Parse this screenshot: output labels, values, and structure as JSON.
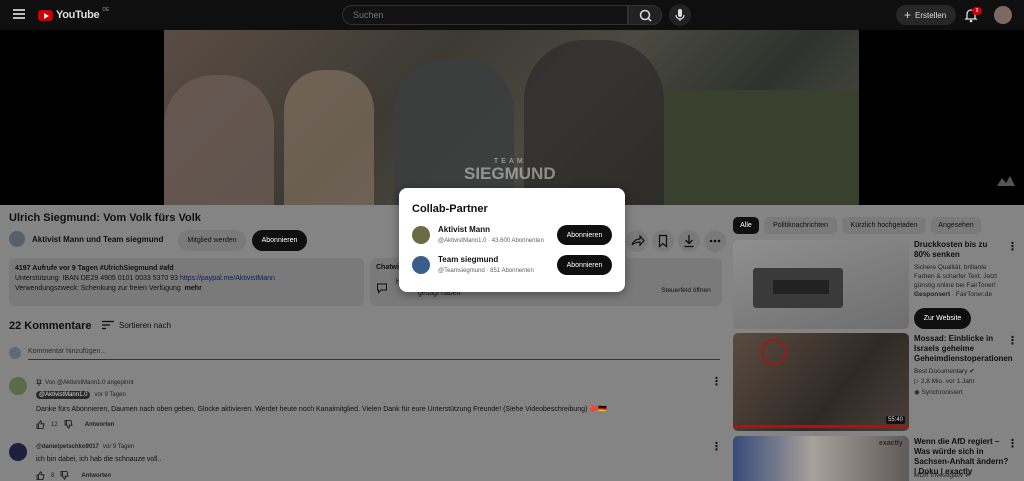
{
  "header": {
    "logo_text": "YouTube",
    "logo_country": "DE",
    "search_placeholder": "Suchen",
    "create_label": "Erstellen",
    "notification_count": "9"
  },
  "video": {
    "watermark_line1": "TEAM",
    "watermark_line2": "SIEGMUND",
    "title": "Ulrich Siegmund: Vom Volk fürs Volk",
    "channel": "Aktivist Mann und Team siegmund",
    "join_label": "Mitglied werden",
    "subscribe_label": "Abonnieren"
  },
  "description": {
    "meta": "4197 Aufrufe  vor 9 Tagen  #UlrichSiegmund #afd",
    "line2_prefix": "Unterstützung: IBAN DE29 4905 0101 0033 5370 93 ",
    "line2_link": "https://paypal.me/AktivistMann",
    "line3": "Verwendungszweck: Schenkung zur freien Verfügung",
    "more": "mehr"
  },
  "chat": {
    "label": "Chatwi",
    "text_prefix": "h",
    "text_line2": "gesagt haben.",
    "open_label": "Steuerfeld öffnen"
  },
  "comments": {
    "header": "22 Kommentare",
    "sort_label": "Sortieren nach",
    "add_placeholder": "Kommentar hinzufügen...",
    "items": [
      {
        "pinned": "Von @AktivistMann1.0 angepinnt",
        "author": "@AktivistMann1.0",
        "time": "vor 9 Tagen",
        "text": "Danke fürs Abonnieren, Daumen nach oben geben, Glocke aktivieren. Werdet heute noch Kanalmitglied. Vielen Dank für eure Unterstützung Freunde! (Siehe Videobeschreibung) ❤️🇩🇪",
        "likes": "12",
        "reply": "Antworten"
      },
      {
        "author": "@danielpetschko9017",
        "time": "vor 9 Tagen",
        "text": "ich bin dabei, ich hab die schnauze voll..",
        "likes": "8",
        "reply": "Antworten"
      }
    ]
  },
  "chips": [
    "Alle",
    "Politiknachrichten",
    "Kürzlich hochgeladen",
    "Angesehen"
  ],
  "sidebar": {
    "ad": {
      "title": "Druckkosten bis zu 80% senken",
      "desc": "Sichere Qualität, brillante Farben & scharfer Text. Jetzt günstig online bei FairToner!",
      "sponsored": "Gesponsert",
      "advertiser": "· FairToner.de",
      "cta": "Zur Website"
    },
    "videos": [
      {
        "title": "Mossad: Einblicke in Israels geheime Geheimdienstoperationen",
        "channel": "Best Documentary",
        "stats": "2,8 Mio.  vor 1 Jahr",
        "badge": "Synchronisiert",
        "duration": "55:40"
      },
      {
        "title": "Wenn die AfD regiert – Was würde sich in Sachsen-Anhalt ändern? | Doku | exactly",
        "channel": "MDR Investigativ",
        "thumb_tag": "exactly"
      }
    ]
  },
  "modal": {
    "title": "Collab-Partner",
    "partners": [
      {
        "name": "Aktivist Mann",
        "sub": "@AktivistMann1.0 · 43.600 Abonnenten",
        "button": "Abonnieren"
      },
      {
        "name": "Team siegmund",
        "sub": "@Teamsiegmund · 851 Abonnenten",
        "button": "Abonnieren"
      }
    ]
  }
}
